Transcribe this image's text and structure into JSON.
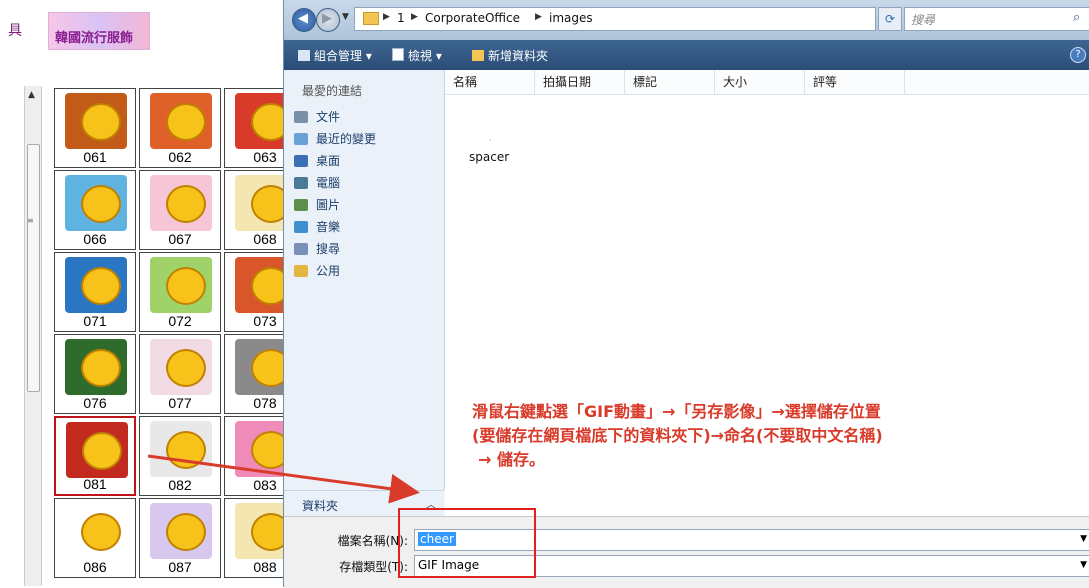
{
  "background_page": {
    "side_label": "具",
    "banner_text": "韓國流行服飾",
    "emoticons": [
      {
        "num": "061",
        "color": "#c25b18"
      },
      {
        "num": "062",
        "color": "#e0602a"
      },
      {
        "num": "063",
        "color": "#d93b2b"
      },
      {
        "num": "066",
        "color": "#5fb3e0"
      },
      {
        "num": "067",
        "color": "#f6c6d6"
      },
      {
        "num": "068",
        "color": "#f3e6b0"
      },
      {
        "num": "071",
        "color": "#2a76c2"
      },
      {
        "num": "072",
        "color": "#9fd36a"
      },
      {
        "num": "073",
        "color": "#d9562a"
      },
      {
        "num": "076",
        "color": "#2f6b2a"
      },
      {
        "num": "077",
        "color": "#f3dbe6"
      },
      {
        "num": "078",
        "color": "#8a8a8a"
      },
      {
        "num": "081",
        "color": "#c22a20"
      },
      {
        "num": "082",
        "color": "#e8e8e8"
      },
      {
        "num": "083",
        "color": "#f08ab8"
      },
      {
        "num": "086",
        "color": "#ffffff"
      },
      {
        "num": "087",
        "color": "#d8c8f0"
      },
      {
        "num": "088",
        "color": "#f3e6b0"
      }
    ]
  },
  "dialog": {
    "address": {
      "crumbs": [
        "1",
        "CorporateOffice",
        "images"
      ]
    },
    "search_placeholder": "搜尋",
    "toolbar": {
      "organize": "組合管理",
      "views": "檢視",
      "new_folder": "新增資料夾",
      "help": "?"
    },
    "nav": {
      "header": "最愛的連結",
      "items": [
        {
          "label": "文件",
          "color": "#7a8fa8"
        },
        {
          "label": "最近的變更",
          "color": "#6aa0d8"
        },
        {
          "label": "桌面",
          "color": "#3b6fb3"
        },
        {
          "label": "電腦",
          "color": "#4a7a9a"
        },
        {
          "label": "圖片",
          "color": "#5b8f4a"
        },
        {
          "label": "音樂",
          "color": "#3d8fd0"
        },
        {
          "label": "搜尋",
          "color": "#7a8fb8"
        },
        {
          "label": "公用",
          "color": "#e2b640"
        }
      ],
      "folders_label": "資料夾"
    },
    "columns": [
      "名稱",
      "拍攝日期",
      "標記",
      "大小",
      "評等"
    ],
    "files": [
      "spacer"
    ],
    "file_name_label": "檔案名稱(N):",
    "file_name_value": "cheer",
    "file_type_label": "存檔類型(T):",
    "file_type_value": "GIF Image"
  },
  "annotation": {
    "line1": "滑鼠右鍵點選「GIF動畫」→「另存影像」→選擇儲存位置",
    "line2": "(要儲存在網頁檔底下的資料夾下)→命名(不要取中文名稱)",
    "line3": "→ 儲存。",
    "color": "#d93b2b"
  }
}
